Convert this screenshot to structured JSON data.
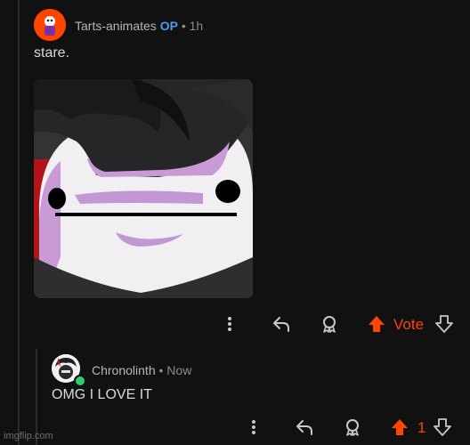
{
  "parent_comment": {
    "username": "Tarts-animates",
    "op_badge": "OP",
    "separator": "•",
    "timestamp": "1h",
    "text": "stare.",
    "vote_label": "Vote"
  },
  "reply_comment": {
    "username": "Chronolinth",
    "separator": "•",
    "timestamp": "Now",
    "text": "OMG I LOVE IT",
    "vote_count": "1",
    "online": true
  },
  "footer": {
    "watermark": "imgflip.com"
  },
  "colors": {
    "background": "#111111",
    "upvote_active": "#ff4500",
    "op_badge": "#4a9cf5",
    "muted_text": "#8a8c8e",
    "online_dot": "#2ecc71"
  },
  "icons": [
    "avatar-tarts",
    "more-icon",
    "reply-icon",
    "award-icon",
    "upvote-icon",
    "downvote-icon",
    "avatar-chronolinth"
  ]
}
